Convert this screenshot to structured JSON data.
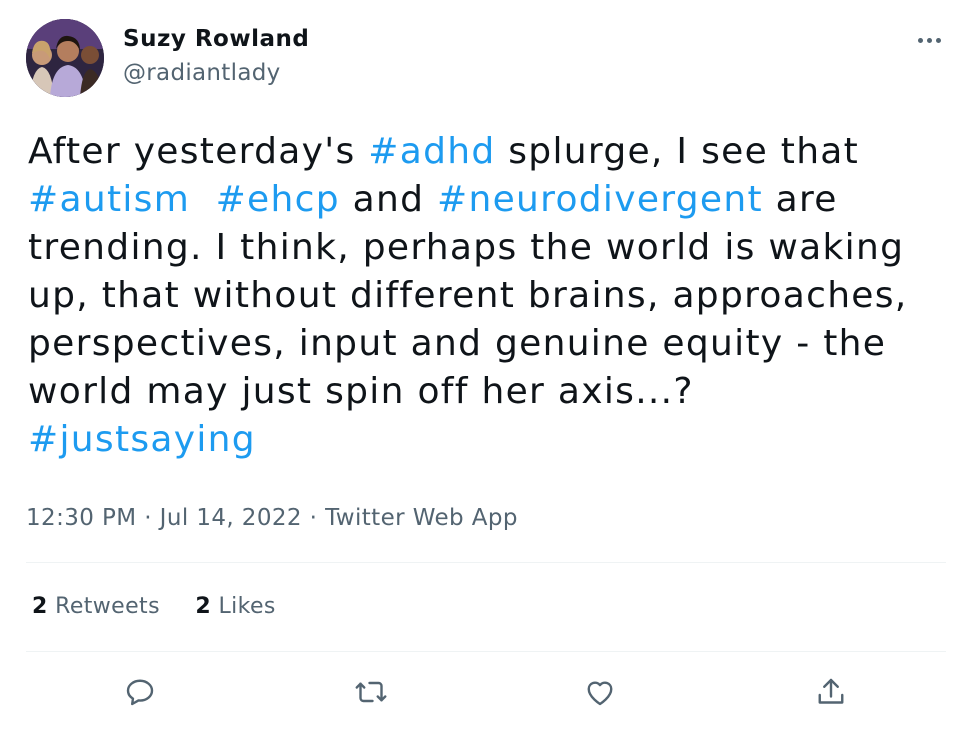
{
  "user": {
    "display_name": "Suzy Rowland",
    "handle": "@radiantlady",
    "avatar_icon": "profile-photo"
  },
  "tweet": {
    "lines": [
      [
        {
          "text": "After yesterday's ",
          "tag": false
        },
        {
          "text": "#adhd",
          "tag": true
        },
        {
          "text": " splurge, I see that",
          "tag": false
        }
      ],
      [
        {
          "text": "#autism",
          "tag": true
        },
        {
          "text": "  ",
          "tag": false
        },
        {
          "text": "#ehcp",
          "tag": true
        },
        {
          "text": " and ",
          "tag": false
        },
        {
          "text": "#neurodivergent",
          "tag": true
        },
        {
          "text": " are",
          "tag": false
        }
      ],
      [
        {
          "text": "trending. I think, perhaps the world is waking",
          "tag": false
        }
      ],
      [
        {
          "text": "up, that without different brains, approaches,",
          "tag": false
        }
      ],
      [
        {
          "text": "perspectives, input and genuine equity - the",
          "tag": false
        }
      ],
      [
        {
          "text": "world may just spin off her axis...?",
          "tag": false
        }
      ],
      [
        {
          "text": "#justsaying",
          "tag": true
        }
      ]
    ]
  },
  "meta": {
    "time": "12:30 PM",
    "sep1": " · ",
    "date": "Jul 14, 2022",
    "sep2": " · ",
    "source": "Twitter Web App"
  },
  "stats": {
    "retweets_count": "2",
    "retweets_label": "Retweets",
    "likes_count": "2",
    "likes_label": "Likes"
  },
  "actions": {
    "icons": [
      "reply-icon",
      "retweet-icon",
      "like-icon",
      "share-icon"
    ]
  },
  "colors": {
    "text": "#0f1419",
    "secondary": "#536471",
    "link": "#1d9bf0",
    "divider": "#eff3f4"
  }
}
